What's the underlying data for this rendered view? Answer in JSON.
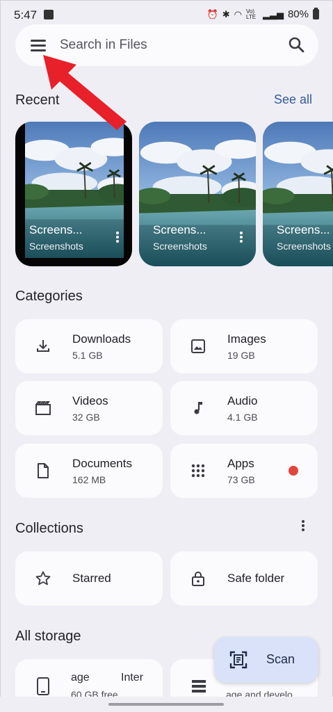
{
  "status": {
    "time": "5:47",
    "battery": "80%",
    "lte": "Vo) LTE"
  },
  "search": {
    "placeholder": "Search in Files"
  },
  "recent": {
    "title": "Recent",
    "see_all": "See all",
    "cards": [
      {
        "title": "Screens...",
        "subtitle": "Screenshots"
      },
      {
        "title": "Screens...",
        "subtitle": "Screenshots"
      },
      {
        "title": "Screens...",
        "subtitle": "Screenshots"
      }
    ]
  },
  "categories": {
    "title": "Categories",
    "items": [
      {
        "label": "Downloads",
        "size": "5.1 GB",
        "icon": "download-icon"
      },
      {
        "label": "Images",
        "size": "19 GB",
        "icon": "image-icon"
      },
      {
        "label": "Videos",
        "size": "32 GB",
        "icon": "video-icon"
      },
      {
        "label": "Audio",
        "size": "4.1 GB",
        "icon": "music-note-icon"
      },
      {
        "label": "Documents",
        "size": "162 MB",
        "icon": "document-icon"
      },
      {
        "label": "Apps",
        "size": "73 GB",
        "icon": "apps-grid-icon"
      }
    ]
  },
  "collections": {
    "title": "Collections",
    "items": [
      {
        "label": "Starred",
        "icon": "star-icon"
      },
      {
        "label": "Safe folder",
        "icon": "lock-icon"
      }
    ]
  },
  "storage": {
    "title": "All storage",
    "internal_a": "age",
    "internal_b": "Inter",
    "internal_free": "60 GB free",
    "other_sub": "age and develo"
  },
  "fab": {
    "label": "Scan"
  },
  "colors": {
    "background": "#eeeef4",
    "surface": "#fbfbfd",
    "accent": "#355b9a",
    "fab": "#d9e2f8",
    "annotation": "#e8202a"
  }
}
